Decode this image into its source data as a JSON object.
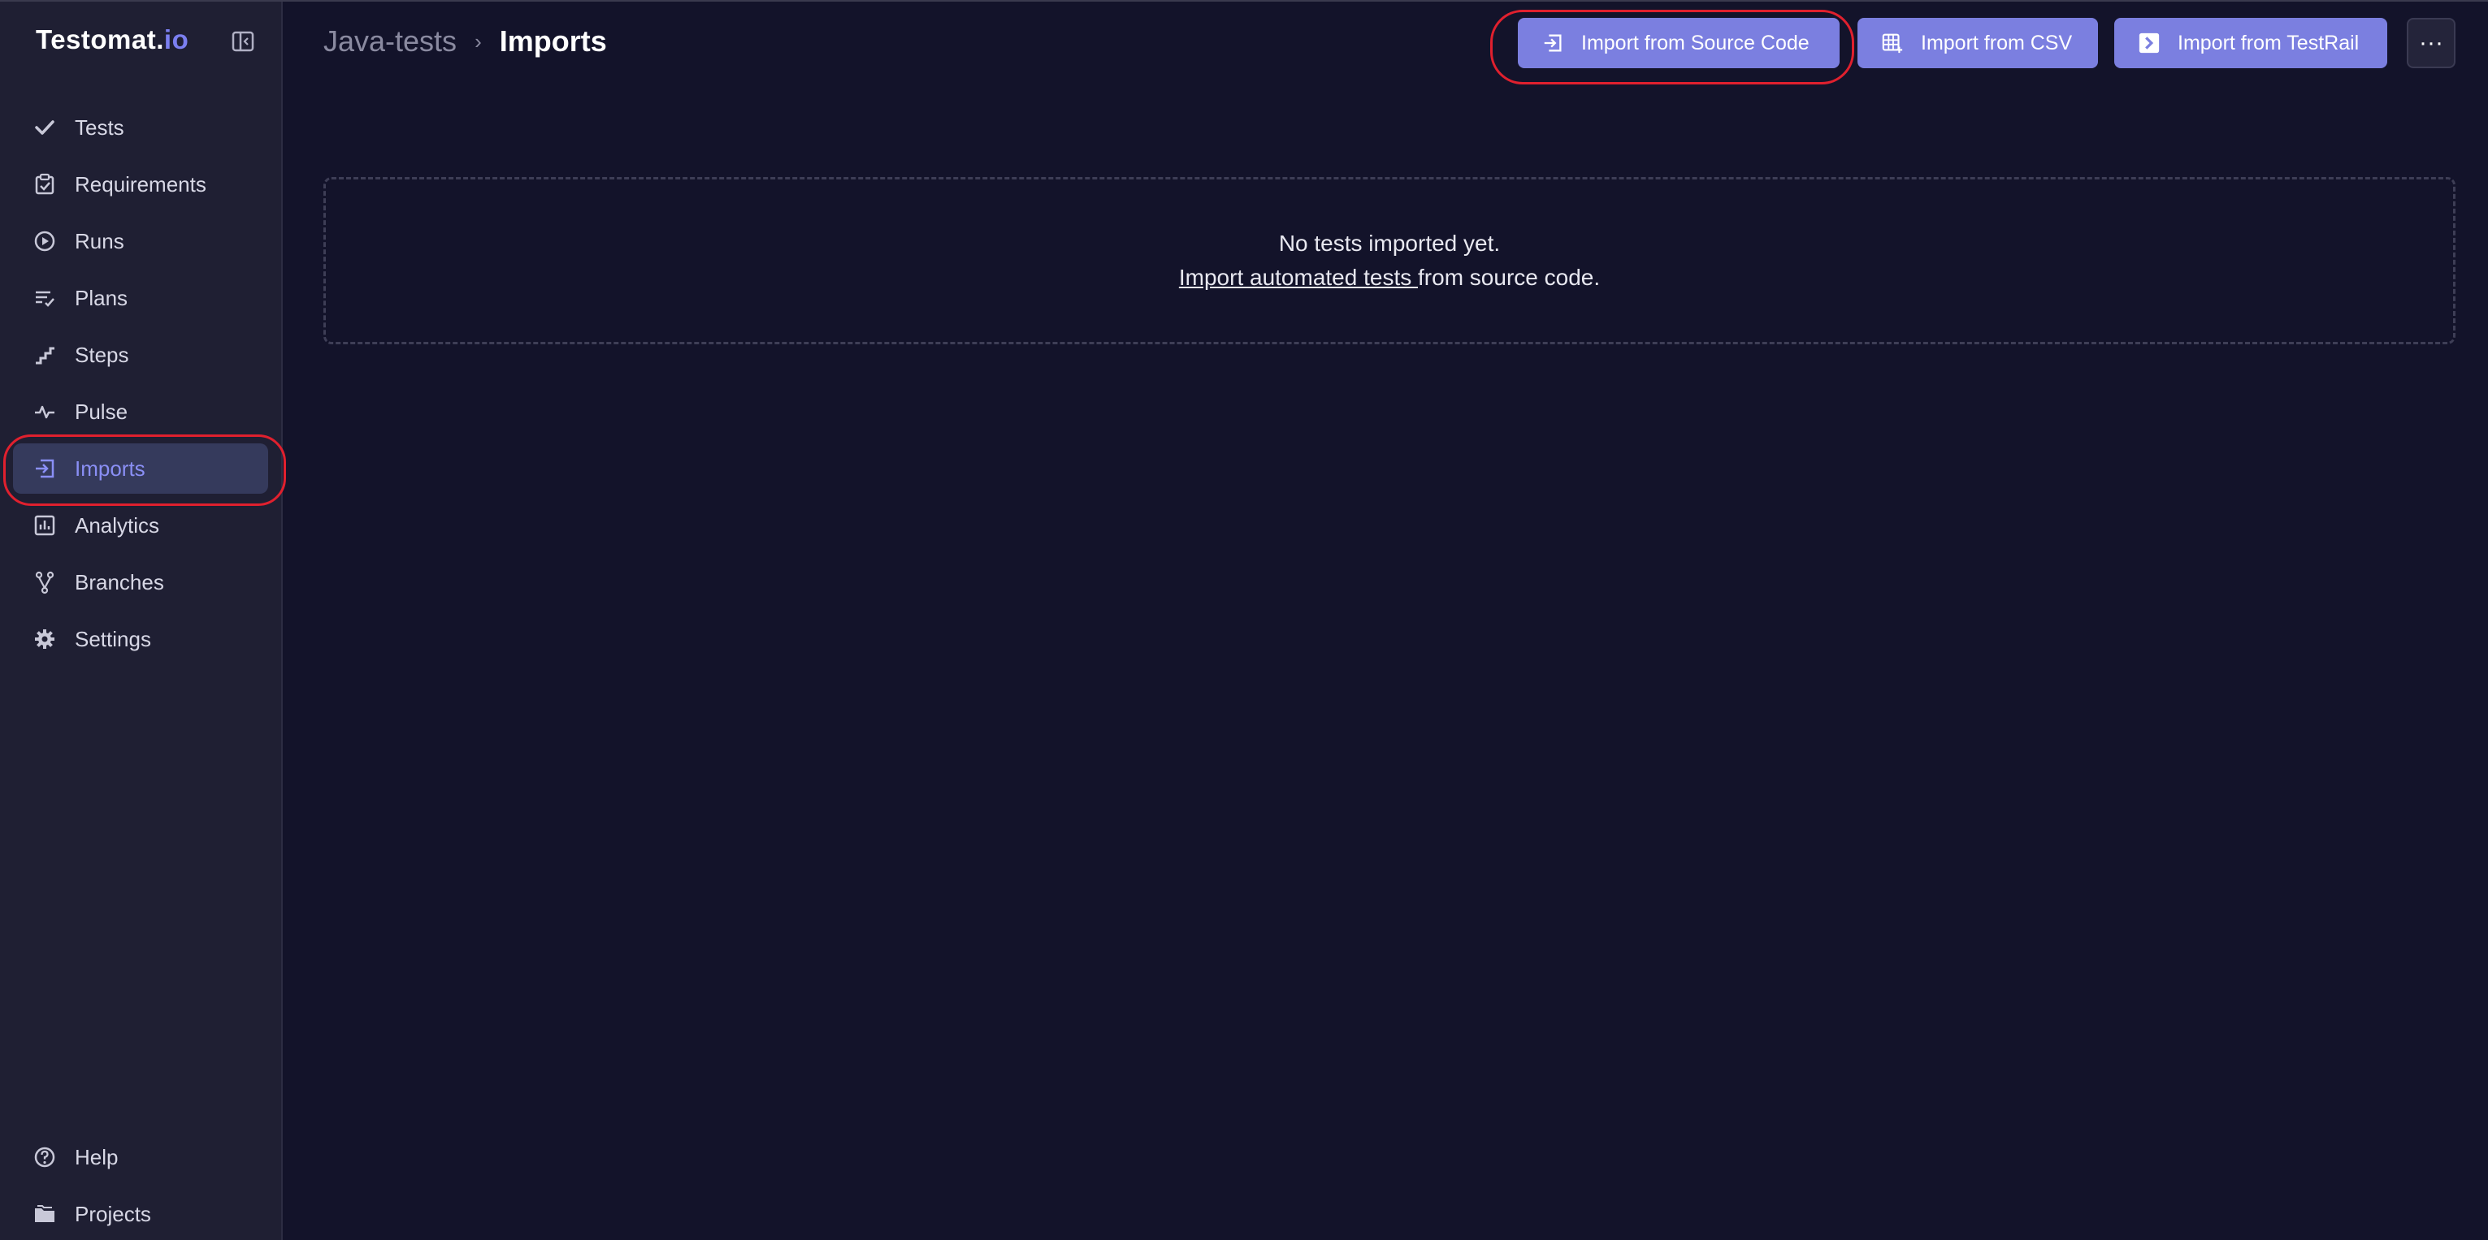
{
  "app": {
    "logo_prefix": "Testomat.",
    "logo_suffix": "io"
  },
  "sidebar": {
    "items": [
      {
        "label": "Tests",
        "icon": "check-icon"
      },
      {
        "label": "Requirements",
        "icon": "clipboard-check-icon"
      },
      {
        "label": "Runs",
        "icon": "play-circle-icon"
      },
      {
        "label": "Plans",
        "icon": "list-check-icon"
      },
      {
        "label": "Steps",
        "icon": "stairs-icon"
      },
      {
        "label": "Pulse",
        "icon": "pulse-icon"
      },
      {
        "label": "Imports",
        "icon": "import-icon",
        "active": true
      },
      {
        "label": "Analytics",
        "icon": "chart-icon"
      },
      {
        "label": "Branches",
        "icon": "branch-icon"
      },
      {
        "label": "Settings",
        "icon": "gear-icon"
      }
    ],
    "footer": [
      {
        "label": "Help",
        "icon": "help-icon"
      },
      {
        "label": "Projects",
        "icon": "folder-icon"
      }
    ]
  },
  "header": {
    "breadcrumb_parent": "Java-tests",
    "breadcrumb_current": "Imports",
    "buttons": {
      "source_code": "Import from Source Code",
      "csv": "Import from CSV",
      "testrail": "Import from TestRail"
    },
    "more": "···"
  },
  "empty_state": {
    "line1": "No tests imported yet.",
    "link": "Import automated tests ",
    "line2_rest": "from source code."
  },
  "colors": {
    "background": "#13132a",
    "sidebar": "#1f1f33",
    "accent": "#7b7fe0",
    "annotation": "#e0202e"
  }
}
